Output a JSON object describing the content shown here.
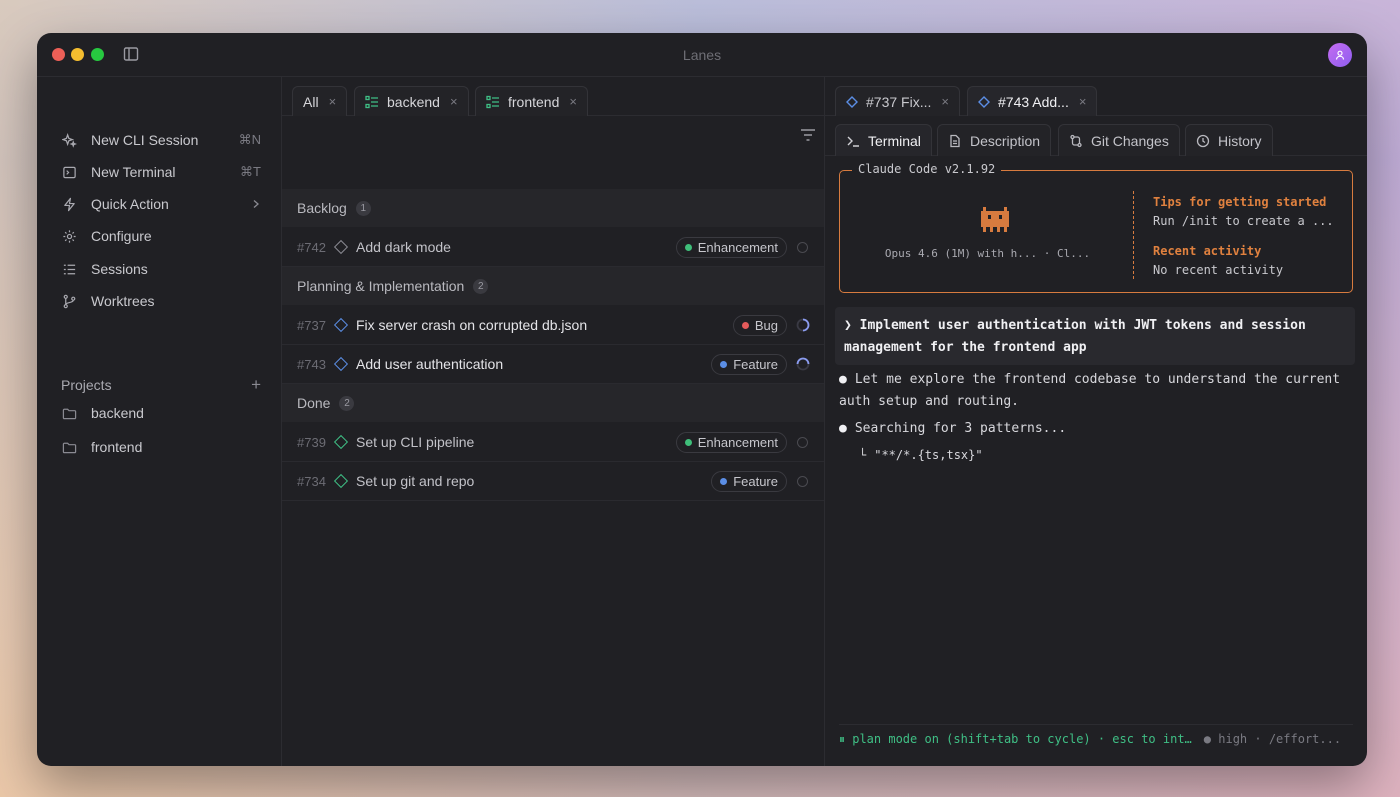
{
  "app": {
    "title": "Lanes"
  },
  "sidebar": {
    "items": [
      {
        "label": "New CLI Session",
        "shortcut": "⌘N",
        "icon": "sparkle-icon"
      },
      {
        "label": "New Terminal",
        "shortcut": "⌘T",
        "icon": "terminal-icon"
      },
      {
        "label": "Quick Action",
        "shortcut": "",
        "icon": "bolt-icon"
      },
      {
        "label": "Configure",
        "shortcut": "",
        "icon": "gear-icon"
      },
      {
        "label": "Sessions",
        "shortcut": "",
        "icon": "list-icon"
      },
      {
        "label": "Worktrees",
        "shortcut": "",
        "icon": "branch-icon"
      }
    ],
    "projects_label": "Projects",
    "projects_add": "+",
    "projects": [
      {
        "name": "backend"
      },
      {
        "name": "frontend"
      }
    ]
  },
  "board": {
    "tabs": [
      {
        "label": "All",
        "close": "×"
      },
      {
        "label": "backend",
        "close": "×"
      },
      {
        "label": "frontend",
        "close": "×"
      }
    ],
    "groups": [
      {
        "name": "Backlog",
        "count": "1"
      },
      {
        "name": "Planning & Implementation",
        "count": "2"
      },
      {
        "name": "Done",
        "count": "2"
      }
    ],
    "tasks": [
      {
        "id": "#742",
        "title": "Add dark mode",
        "tag": "Enhancement",
        "tag_color": "#3fbf7a"
      },
      {
        "id": "#737",
        "title": "Fix server crash on corrupted db.json",
        "tag": "Bug",
        "tag_color": "#e55b5b"
      },
      {
        "id": "#743",
        "title": "Add user authentication",
        "tag": "Feature",
        "tag_color": "#5b8ee5"
      },
      {
        "id": "#739",
        "title": "Set up CLI pipeline",
        "tag": "Enhancement",
        "tag_color": "#3fbf7a"
      },
      {
        "id": "#734",
        "title": "Set up git and repo",
        "tag": "Feature",
        "tag_color": "#5b8ee5"
      }
    ]
  },
  "detail": {
    "tabs": [
      {
        "label": "#737 Fix...",
        "close": "×"
      },
      {
        "label": "#743 Add...",
        "close": "×"
      }
    ],
    "subtabs": [
      "Terminal",
      "Description",
      "Git Changes",
      "History"
    ],
    "terminal": {
      "box_title": "Claude Code v2.1.92",
      "model_line": "Opus 4.6 (1M) with h... · Cl...",
      "tips_heading": "Tips for getting started",
      "tips_text": "Run /init to create a ...",
      "recent_heading": "Recent activity",
      "recent_text": "No recent activity",
      "prompt": "❯ Implement user authentication with JWT tokens and session management for the frontend app",
      "lines": [
        "Let me explore the frontend codebase to understand the current auth setup and routing.",
        "Searching for 3 patterns...",
        "\"**/*.{ts,tsx}\""
      ],
      "bullet": "●",
      "sub_prefix": "└",
      "status_plan": "⏸ plan mode on (shift+tab to cycle) · esc to int…",
      "status_effort": "● high · /effort..."
    }
  },
  "colors": {
    "accent_orange": "#d77b3f",
    "accent_green": "#3fbf85",
    "accent_blue": "#5b8ee5"
  }
}
